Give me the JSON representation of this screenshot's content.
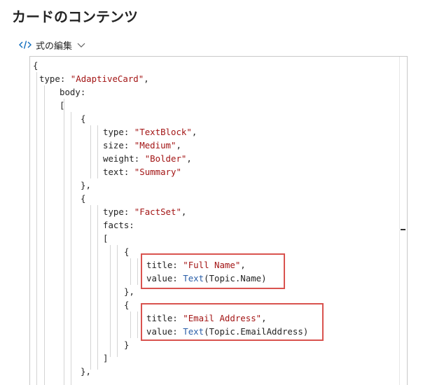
{
  "page": {
    "title": "カードのコンテンツ"
  },
  "toolbar": {
    "label": "式の編集",
    "code_icon": "code-icon",
    "chevron_icon": "chevron-down-icon"
  },
  "code": {
    "l1": "{",
    "l2_key": "type:",
    "l2_val": "\"AdaptiveCard\"",
    "l2_end": ",",
    "l3": "body:",
    "l4": "[",
    "l5": "{",
    "l6_key": "type:",
    "l6_val": "\"TextBlock\"",
    "l6_end": ",",
    "l7_key": "size:",
    "l7_val": "\"Medium\"",
    "l7_end": ",",
    "l8_key": "weight:",
    "l8_val": "\"Bolder\"",
    "l8_end": ",",
    "l9_key": "text:",
    "l9_val": "\"Summary\"",
    "l10": "},",
    "l11": "{",
    "l12_key": "type:",
    "l12_val": "\"FactSet\"",
    "l12_end": ",",
    "l13": "facts:",
    "l14": "[",
    "l15": "{",
    "l16_key": "title:",
    "l16_val": "\"Full Name\"",
    "l16_end": ",",
    "l17_key": "value:",
    "l17_fn": "Text",
    "l17_arg": "(Topic.Name)",
    "l18": "},",
    "l19": "{",
    "l20_key": "title:",
    "l20_val": "\"Email Address\"",
    "l20_end": ",",
    "l21_key": "value:",
    "l21_fn": "Text",
    "l21_arg": "(Topic.EmailAddress)",
    "l22": "}",
    "l23": "]",
    "l24": "},"
  },
  "colors": {
    "highlight": "#d9534f",
    "string": "#a31515",
    "function": "#2b5fa8"
  }
}
